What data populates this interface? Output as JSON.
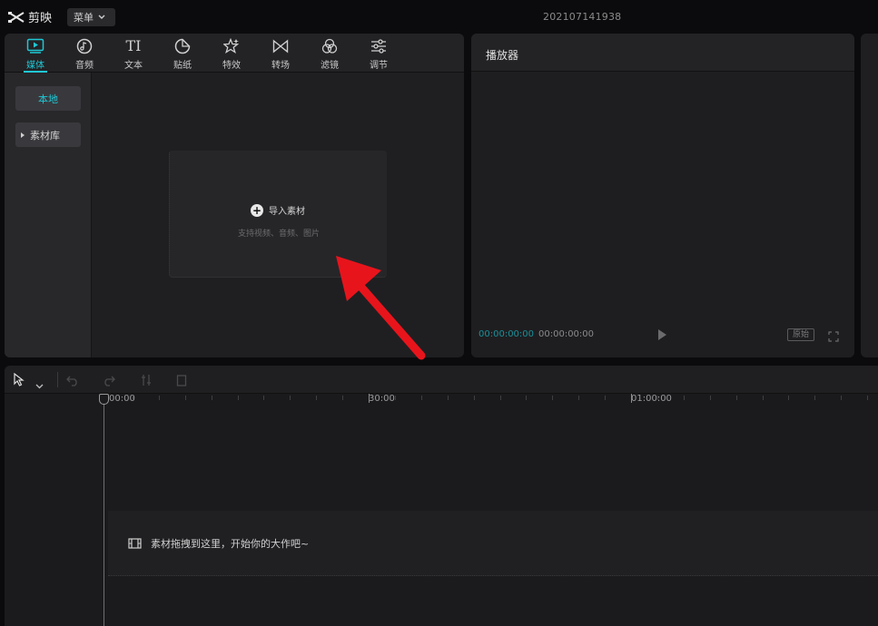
{
  "titlebar": {
    "app_name": "剪映",
    "menu_label": "菜单",
    "project_name": "202107141938"
  },
  "media_toolbar": {
    "tabs": [
      {
        "label": "媒体",
        "icon": "media-icon",
        "active": true
      },
      {
        "label": "音频",
        "icon": "audio-icon"
      },
      {
        "label": "文本",
        "icon": "text-icon"
      },
      {
        "label": "贴纸",
        "icon": "sticker-icon"
      },
      {
        "label": "特效",
        "icon": "effects-icon"
      },
      {
        "label": "转场",
        "icon": "transition-icon"
      },
      {
        "label": "滤镜",
        "icon": "filter-icon"
      },
      {
        "label": "调节",
        "icon": "adjust-icon"
      }
    ],
    "text_icon_glyph": "TI"
  },
  "sidebar": {
    "local_label": "本地",
    "library_label": "素材库"
  },
  "import_area": {
    "button_label": "导入素材",
    "plus_glyph": "+",
    "hint": "支持视频、音频、图片"
  },
  "player": {
    "title": "播放器",
    "current_time": "00:00:00:00",
    "total_time": "00:00:00:00",
    "ratio_label": "原始"
  },
  "timeline": {
    "ruler_labels": [
      "00:00",
      "30:00",
      "01:00:00"
    ],
    "main_track_hint": "素材拖拽到这里，开始你的大作吧~"
  },
  "colors": {
    "accent": "#1fc7d4",
    "arrow": "#e8141c"
  }
}
